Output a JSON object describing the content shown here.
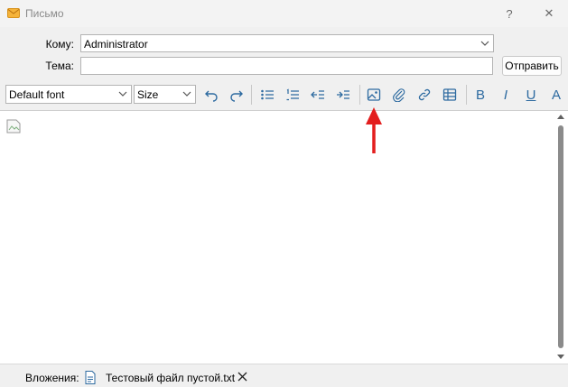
{
  "window": {
    "title": "Письмо",
    "help_label": "?",
    "close_label": "✕"
  },
  "form": {
    "to_label": "Кому:",
    "to_value": "Administrator",
    "subject_label": "Тема:",
    "subject_value": "",
    "send_label": "Отправить"
  },
  "toolbar": {
    "font_value": "Default font",
    "size_value": "Size",
    "bold": "B",
    "italic": "I",
    "underline": "U",
    "color": "A"
  },
  "attachments": {
    "label": "Вложения:",
    "file_name": "Тестовый файл пустой.txt"
  },
  "colors": {
    "accent": "#2d6aa0",
    "annotation_arrow": "#e31e1e"
  }
}
